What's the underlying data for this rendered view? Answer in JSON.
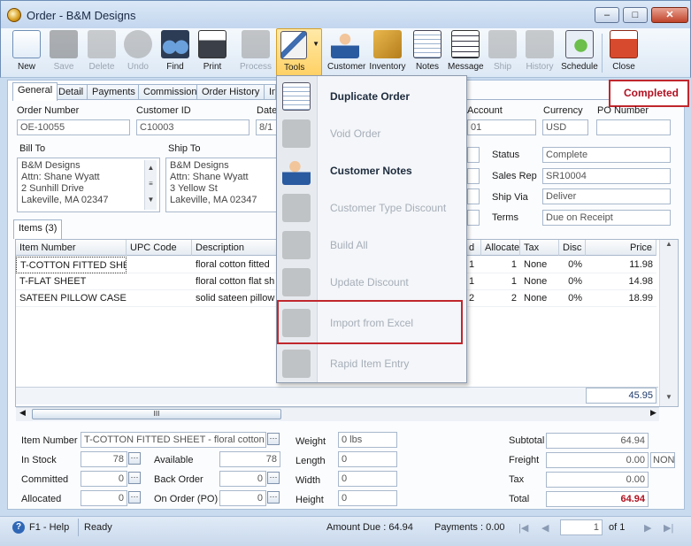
{
  "window": {
    "title": "Order - B&M Designs"
  },
  "window_controls": {
    "minimize": "‒",
    "maximize": "□",
    "close": "✕"
  },
  "toolbar": {
    "new": "New",
    "save": "Save",
    "delete": "Delete",
    "undo": "Undo",
    "find": "Find",
    "print": "Print",
    "process": "Process",
    "tools": "Tools",
    "customer": "Customer",
    "inventory": "Inventory",
    "notes": "Notes",
    "message": "Message",
    "ship": "Ship",
    "history": "History",
    "schedule": "Schedule",
    "close": "Close"
  },
  "tabs": [
    "General",
    "Detail",
    "Payments",
    "Commission",
    "Order History",
    "In"
  ],
  "status_badge": "Completed",
  "header": {
    "order_number_label": "Order Number",
    "order_number": "OE-10055",
    "customer_id_label": "Customer ID",
    "customer_id": "C10003",
    "date_label": "Date",
    "date_value": "8/1",
    "account_label": "Account",
    "account_value": "01",
    "currency_label": "Currency",
    "currency": "USD",
    "po_label": "PO Number",
    "po_value": ""
  },
  "bill_to": {
    "label": "Bill To",
    "lines": [
      "B&M Designs",
      "Attn: Shane Wyatt",
      "2 Sunhill Drive",
      "Lakeville, MA 02347"
    ]
  },
  "ship_to": {
    "label": "Ship To",
    "lines": [
      "B&M Designs",
      "Attn: Shane Wyatt",
      "3 Yellow St",
      "Lakeville, MA 02347"
    ]
  },
  "right_fields": {
    "status_label": "Status",
    "status": "Complete",
    "sales_rep_label": "Sales Rep",
    "sales_rep": "SR10004",
    "ship_via_label": "Ship Via",
    "ship_via": "Deliver",
    "terms_label": "Terms",
    "terms": "Due on Receipt"
  },
  "items_tab": "Items (3)",
  "grid": {
    "headers": [
      "Item Number",
      "UPC Code",
      "Description",
      "d",
      "Allocate",
      "Tax",
      "Disc",
      "Price"
    ],
    "rows": [
      [
        "T-COTTON FITTED SHEET",
        "",
        "floral cotton fitted",
        "1",
        "1",
        "None",
        "0%",
        "11.98"
      ],
      [
        "T-FLAT SHEET",
        "",
        "floral cotton flat sh",
        "1",
        "1",
        "None",
        "0%",
        "14.98"
      ],
      [
        "SATEEN PILLOW CASE",
        "",
        "solid sateen pillow",
        "2",
        "2",
        "None",
        "0%",
        "18.99"
      ]
    ],
    "total": "45.95",
    "hscroll_grip": "III"
  },
  "tools_menu": {
    "items": [
      {
        "label": "Duplicate Order",
        "enabled": true
      },
      {
        "label": "Void Order",
        "enabled": false
      },
      {
        "label": "Customer Notes",
        "enabled": true
      },
      {
        "label": "Customer Type Discount",
        "enabled": false
      },
      {
        "label": "Build All",
        "enabled": false
      },
      {
        "label": "Update Discount",
        "enabled": false
      },
      {
        "label": "Import from Excel",
        "enabled": false
      },
      {
        "label": "Rapid Item Entry",
        "enabled": false
      }
    ]
  },
  "bottom": {
    "item_number_label": "Item Number",
    "item_number": "T-COTTON FITTED SHEET - floral cotton fit",
    "in_stock_label": "In Stock",
    "in_stock": "78",
    "available_label": "Available",
    "available": "78",
    "committed_label": "Committed",
    "committed": "0",
    "back_order_label": "Back Order",
    "back_order": "0",
    "allocated_label": "Allocated",
    "allocated": "0",
    "on_order_label": "On Order (PO)",
    "on_order": "0",
    "weight_label": "Weight",
    "weight": "0 lbs",
    "length_label": "Length",
    "length": "0",
    "width_label": "Width",
    "width": "0",
    "height_label": "Height",
    "height": "0",
    "subtotal_label": "Subtotal",
    "subtotal": "64.94",
    "freight_label": "Freight",
    "freight": "0.00",
    "freight_code": "NON",
    "tax_label": "Tax",
    "tax": "0.00",
    "total_label": "Total",
    "total": "64.94"
  },
  "statusbar": {
    "help": "F1 - Help",
    "ready": "Ready",
    "amount_due": "Amount Due : 64.94",
    "payments": "Payments : 0.00",
    "page": "1",
    "of": "of 1"
  },
  "colors": {
    "accent": "#c0272d",
    "total_red": "#b01020",
    "menu_active": "#ffd165"
  }
}
